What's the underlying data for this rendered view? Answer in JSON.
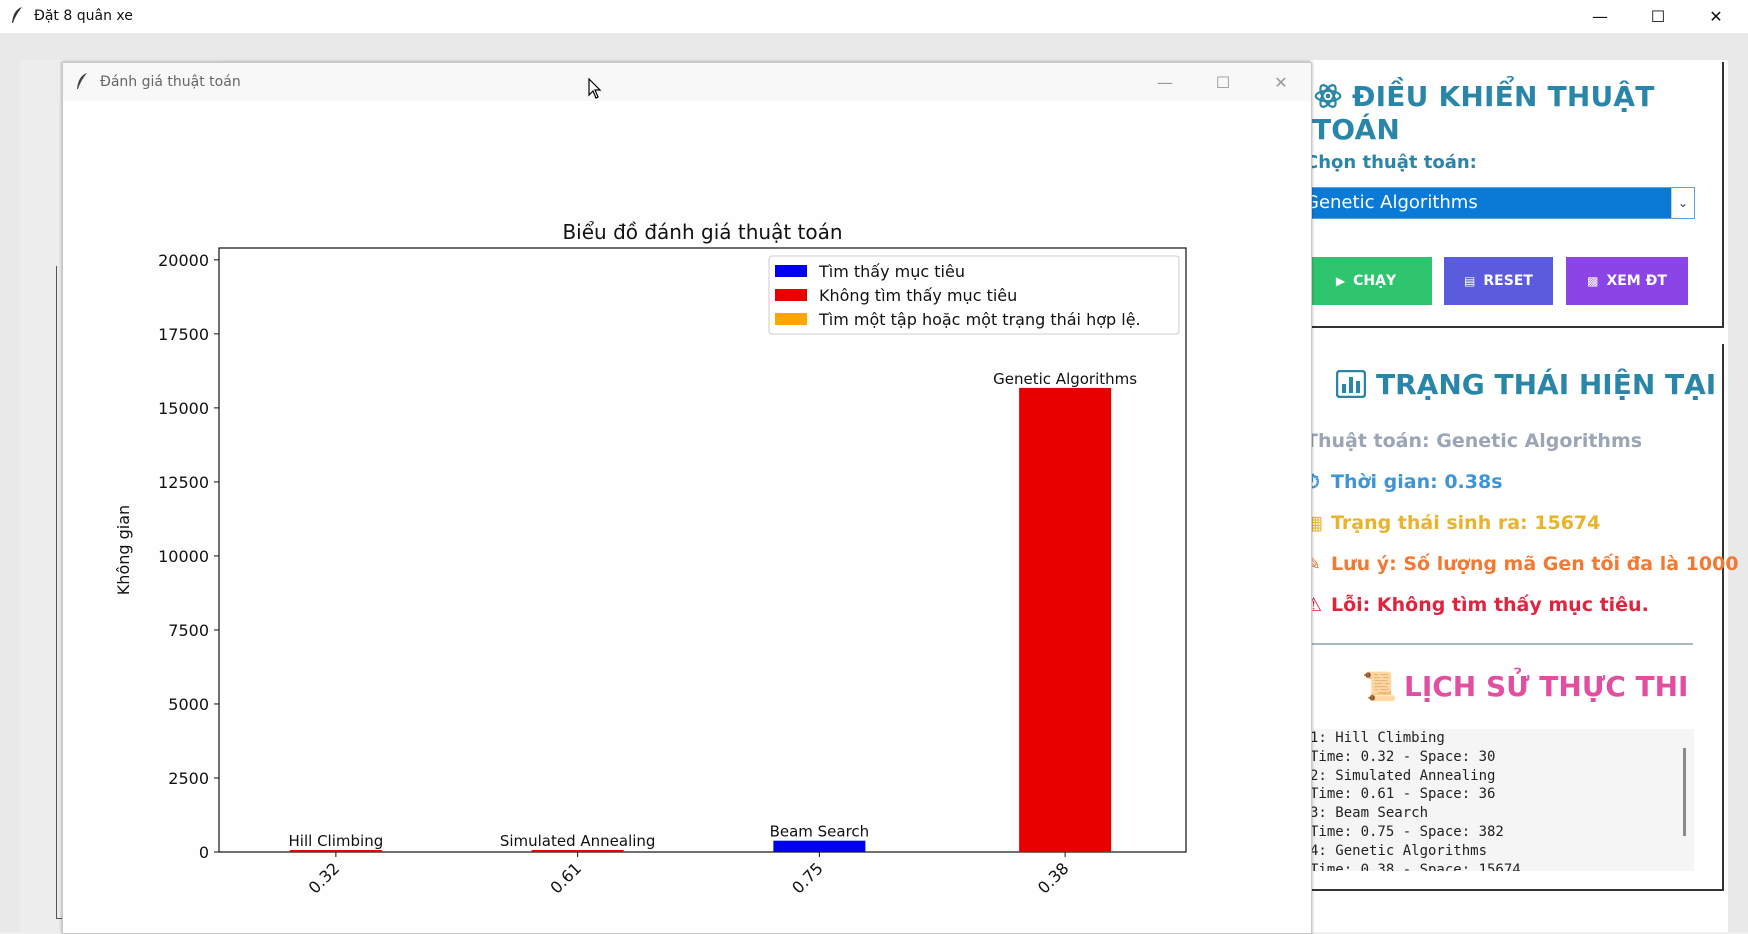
{
  "main_window": {
    "title": "Đặt 8 quân xe",
    "controls": {
      "minimize": "—",
      "maximize": "☐",
      "close": "✕"
    }
  },
  "eval_window": {
    "title": "Đánh giá thuật toán"
  },
  "control_panel": {
    "title": "ĐIỀU KHIỂN THUẬT TOÁN",
    "choose_label": "Chọn thuật toán:",
    "selected_algorithm": "Genetic Algorithms",
    "buttons": {
      "run": "CHẠY",
      "reset": "RESET",
      "view": "XEM ĐT"
    }
  },
  "status_panel": {
    "title": "TRẠNG THÁI HIỆN TẠI",
    "algorithm": "Thuật toán: Genetic Algorithms",
    "time": "Thời gian: 0.38s",
    "states": "Trạng thái sinh ra: 15674",
    "note": "Lưu ý: Số lượng mã Gen tối đa là 1000",
    "error": "Lỗi: Không tìm thấy mục tiêu."
  },
  "history": {
    "title": "LỊCH SỬ THỰC THI",
    "lines": [
      "1: Hill Climbing",
      "Time: 0.32 - Space: 30",
      "2: Simulated Annealing",
      "Time: 0.61 - Space: 36",
      "3: Beam Search",
      "Time: 0.75 - Space: 382",
      "4: Genetic Algorithms",
      "Time: 0.38 - Space: 15674"
    ]
  },
  "colors": {
    "found": "#0000ee",
    "not_found": "#e80000",
    "partial": "#ffa500",
    "accent": "#2a86a8",
    "run_btn": "#2fc56e",
    "reset_btn": "#5b5bde",
    "view_btn": "#8b44e6"
  },
  "chart_data": {
    "type": "bar",
    "title": "Biểu đồ đánh giá thuật toán",
    "xlabel": "",
    "ylabel": "Không gian",
    "categories": [
      "0.32",
      "0.61",
      "0.75",
      "0.38"
    ],
    "bar_labels": [
      "Hill Climbing",
      "Simulated Annealing",
      "Beam Search",
      "Genetic Algorithms"
    ],
    "values": [
      30,
      36,
      382,
      15674
    ],
    "bar_status": [
      "not_found",
      "not_found",
      "found",
      "not_found"
    ],
    "ylim": [
      0,
      20400
    ],
    "yticks": [
      0,
      2500,
      5000,
      7500,
      10000,
      12500,
      15000,
      17500,
      20000
    ],
    "ytick_labels": [
      "0",
      "2500",
      "5000",
      "7500",
      "10000",
      "12500",
      "15000",
      "17500",
      "20000"
    ],
    "legend_position": "top-right",
    "legend": [
      {
        "label": "Tìm thấy mục tiêu",
        "status": "found"
      },
      {
        "label": "Không tìm thấy mục tiêu",
        "status": "not_found"
      },
      {
        "label": "Tìm một tập hoặc một trạng thái hợp lệ.",
        "status": "partial"
      }
    ]
  }
}
